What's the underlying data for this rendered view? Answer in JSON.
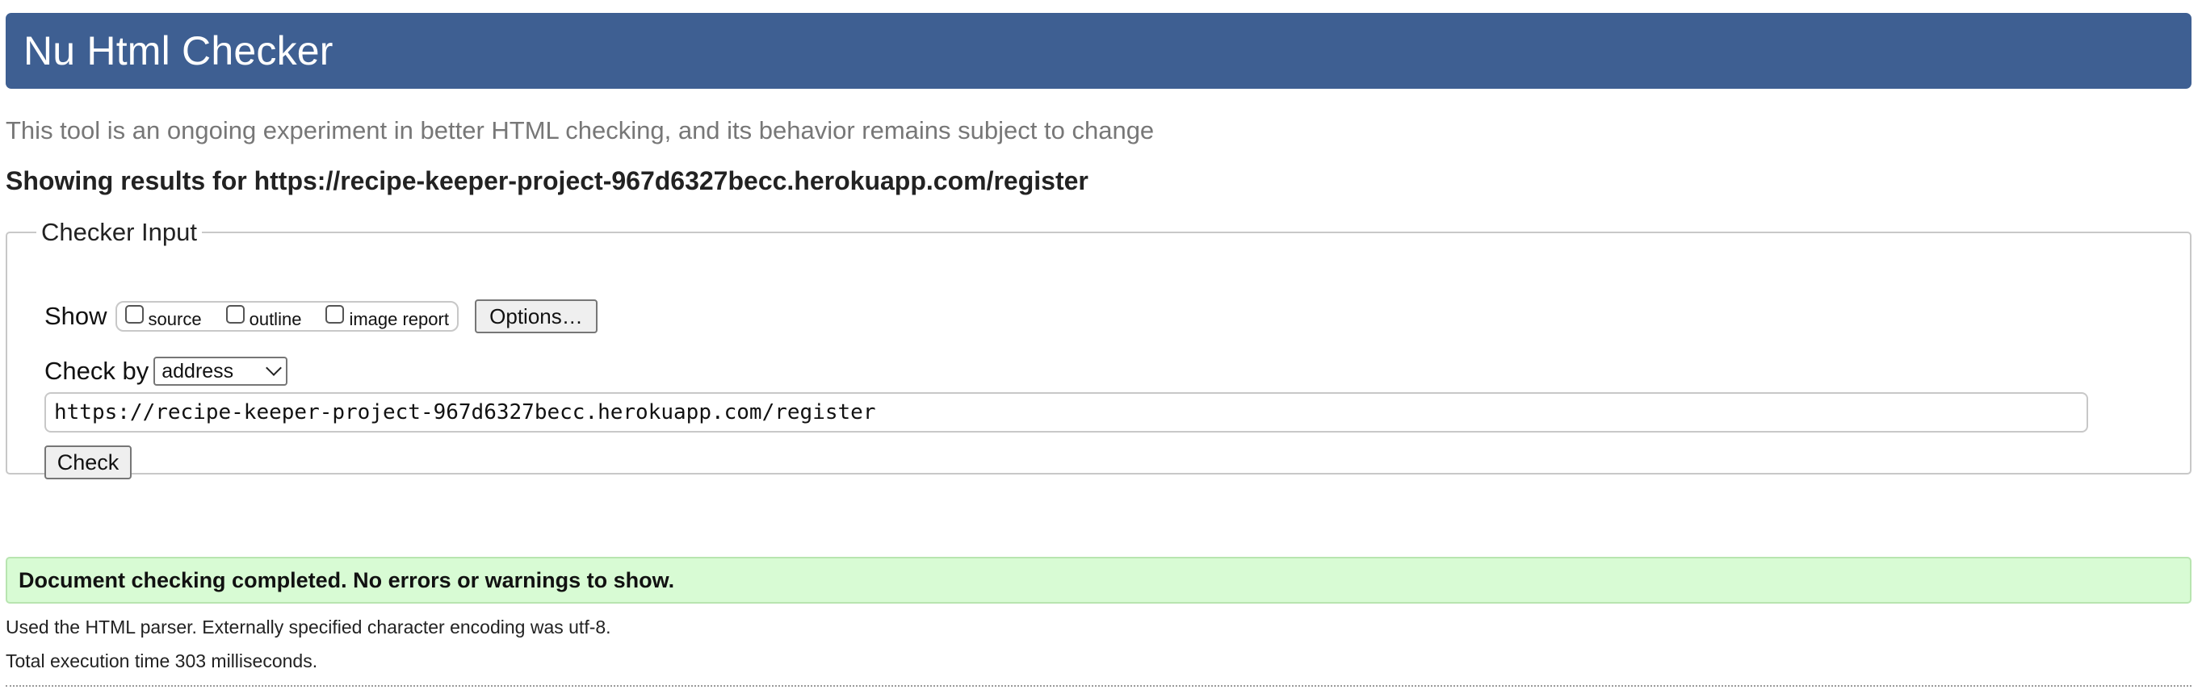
{
  "header": {
    "title": "Nu Html Checker"
  },
  "subtitle": "This tool is an ongoing experiment in better HTML checking, and its behavior remains subject to change",
  "results_heading": "Showing results for https://recipe-keeper-project-967d6327becc.herokuapp.com/register",
  "checker_input": {
    "legend": "Checker Input",
    "show_label": "Show",
    "show_options": [
      {
        "label": "source",
        "checked": false
      },
      {
        "label": "outline",
        "checked": false
      },
      {
        "label": "image report",
        "checked": false
      }
    ],
    "options_button": "Options…",
    "check_by_label": "Check by",
    "check_by_selected": "address",
    "url_value": "https://recipe-keeper-project-967d6327becc.herokuapp.com/register",
    "check_button": "Check"
  },
  "result": {
    "status_message": "Document checking completed. No errors or warnings to show.",
    "parser_info": "Used the HTML parser. Externally specified character encoding was utf-8.",
    "execution_time": "Total execution time 303 milliseconds."
  },
  "colors": {
    "header_bg": "#3e5f92",
    "success_bg": "#d8fbd4"
  }
}
